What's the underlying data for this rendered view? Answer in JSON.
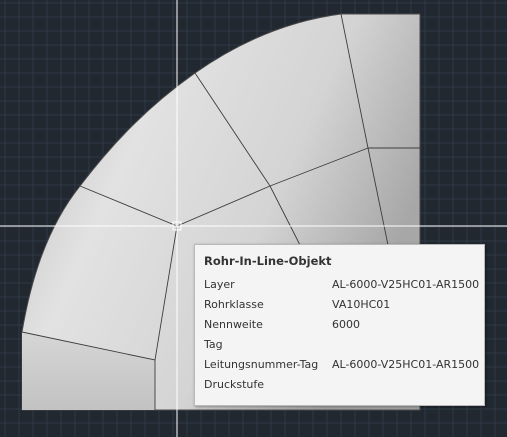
{
  "viewport": {
    "background_color": "#212830",
    "grid_color": "#2f3a46",
    "model_fill": "#d2d2d2",
    "model_edge_color": "#3a3a3a",
    "crosshair_color": "#ffffff",
    "pickbox_color": "#ffffff"
  },
  "tooltip": {
    "title": "Rohr-In-Line-Objekt",
    "rows": [
      {
        "label": "Layer",
        "value": "AL-6000-V25HC01-AR1500"
      },
      {
        "label": "Rohrklasse",
        "value": "VA10HC01"
      },
      {
        "label": "Nennweite",
        "value": "6000"
      },
      {
        "label": "Tag",
        "value": ""
      },
      {
        "label": "Leitungsnummer-Tag",
        "value": "AL-6000-V25HC01-AR1500"
      },
      {
        "label": "Druckstufe",
        "value": ""
      }
    ]
  }
}
